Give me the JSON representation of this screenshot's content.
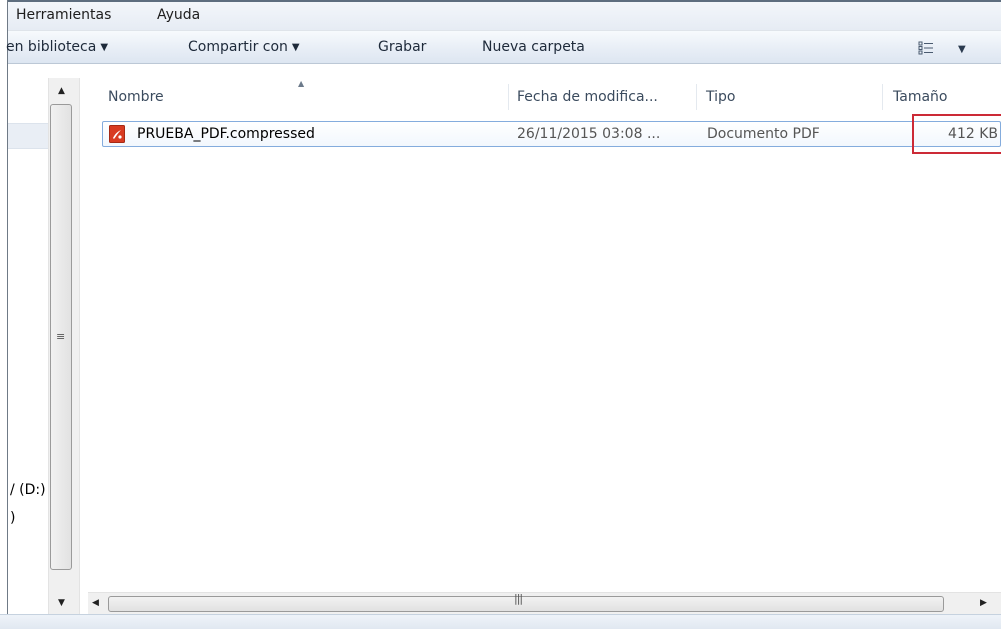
{
  "menu": {
    "items": [
      "Herramientas",
      "Ayuda"
    ]
  },
  "toolbar": {
    "include_library": "en biblioteca",
    "share_with": "Compartir con",
    "burn": "Grabar",
    "new_folder": "Nueva carpeta"
  },
  "nav": {
    "drive_label": "/ (D:)",
    "item_partial": ")"
  },
  "columns": {
    "name": "Nombre",
    "modified": "Fecha de modifica...",
    "type": "Tipo",
    "size": "Tamaño"
  },
  "files": [
    {
      "name": "PRUEBA_PDF.compressed",
      "modified": "26/11/2015 03:08 ...",
      "type": "Documento PDF",
      "size": "412 KB"
    }
  ],
  "icons": {
    "file": "pdf-file-icon",
    "view": "view-options-icon"
  },
  "colors": {
    "highlight": "#cc2a36",
    "selection_border": "#84acdd",
    "pdf_icon": "#d83b22"
  }
}
